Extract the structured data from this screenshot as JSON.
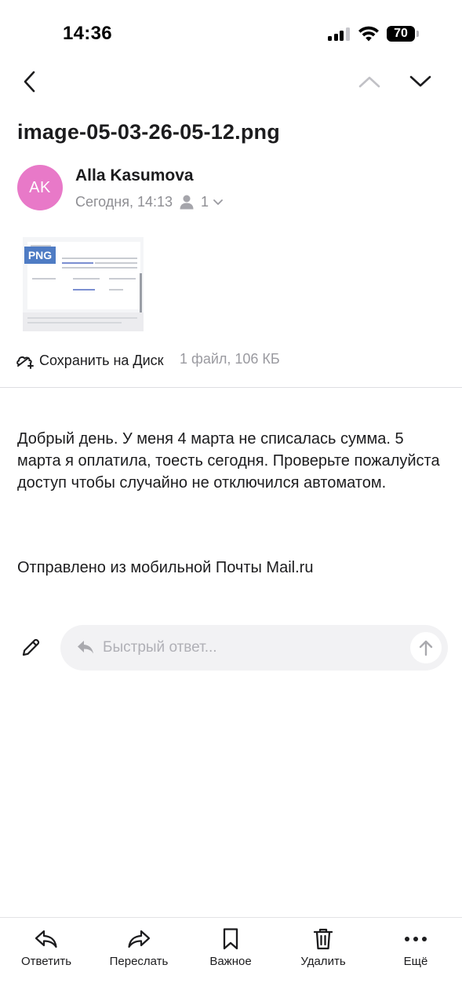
{
  "status_bar": {
    "time": "14:36",
    "battery": "70"
  },
  "message": {
    "subject": "image-05-03-26-05-12.png",
    "sender": {
      "initials": "AK",
      "name": "Alla Kasumova",
      "avatar_color": "#e879c8"
    },
    "date": "Сегодня, 14:13",
    "recipients_count": "1",
    "attachment": {
      "type_badge": "PNG",
      "save_label": "Сохранить на Диск",
      "file_info": "1 файл, 106 КБ"
    },
    "body": "Добрый день. У меня 4 марта не списалась сумма. 5 марта я оплатила, тоесть сегодня. Проверьте пожалуйста доступ чтобы случайно не отключился автоматом.",
    "signature": "Отправлено из мобильной Почты Mail.ru"
  },
  "quick_reply": {
    "placeholder": "Быстрый ответ..."
  },
  "bottom_bar": {
    "reply": "Ответить",
    "forward": "Переслать",
    "important": "Важное",
    "delete": "Удалить",
    "more": "Ещё"
  },
  "icons": {
    "back": "chevron-left-icon",
    "prev": "chevron-up-icon",
    "next": "chevron-down-icon",
    "compose": "pencil-icon",
    "send": "arrow-up-icon"
  }
}
